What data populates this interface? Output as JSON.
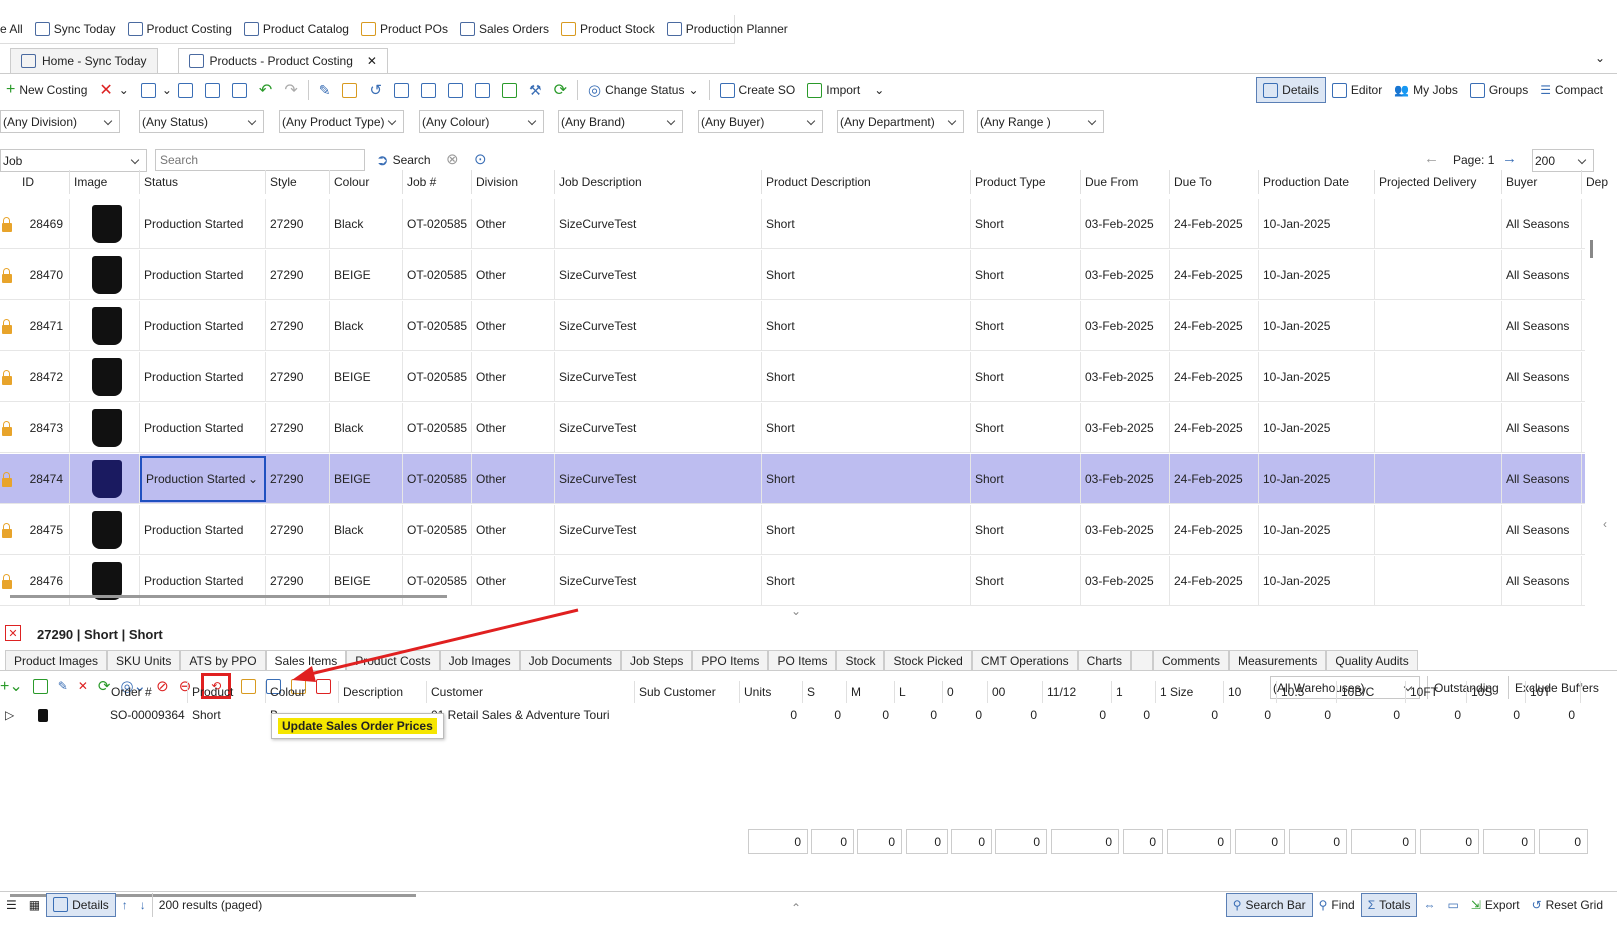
{
  "favorites": [
    "e All",
    "Sync Today",
    "Product Costing",
    "Product Catalog",
    "Product POs",
    "Sales Orders",
    "Product Stock",
    "Production Planner"
  ],
  "doc_tabs": [
    {
      "label": "Home - Sync Today"
    },
    {
      "label": "Products - Product Costing"
    }
  ],
  "toolbar": {
    "new_costing": "New Costing",
    "change_status": "Change Status",
    "create_so": "Create SO",
    "import": "Import"
  },
  "view_buttons": [
    "Details",
    "Editor",
    "My Jobs",
    "Groups",
    "Compact"
  ],
  "filters": [
    "(Any Division)",
    "(Any Status)",
    "(Any Product Type)",
    "(Any Colour)",
    "(Any Brand)",
    "(Any Buyer)",
    "(Any Department)",
    "(Any Range )"
  ],
  "search": {
    "field": "Job",
    "placeholder": "Search",
    "button": "Search",
    "page_label": "Page: 1",
    "page_size": "200"
  },
  "columns": [
    "ID",
    "Image",
    "Status",
    "Style",
    "Colour",
    "Job #",
    "Division",
    "Job Description",
    "Product Description",
    "Product Type",
    "Due From",
    "Due To",
    "Production Date",
    "Projected Delivery",
    "Buyer",
    "Dep"
  ],
  "rows": [
    {
      "id": "28469",
      "status": "Production Started",
      "style": "27290",
      "colour": "Black",
      "job": "OT-020585",
      "division": "Other",
      "job_desc": "SizeCurveTest",
      "prod_desc": "Short",
      "type": "Short",
      "due_from": "03-Feb-2025",
      "due_to": "24-Feb-2025",
      "prod_date": "10-Jan-2025",
      "proj": "",
      "buyer": "All Seasons"
    },
    {
      "id": "28470",
      "status": "Production Started",
      "style": "27290",
      "colour": "BEIGE",
      "job": "OT-020585",
      "division": "Other",
      "job_desc": "SizeCurveTest",
      "prod_desc": "Short",
      "type": "Short",
      "due_from": "03-Feb-2025",
      "due_to": "24-Feb-2025",
      "prod_date": "10-Jan-2025",
      "proj": "",
      "buyer": "All Seasons"
    },
    {
      "id": "28471",
      "status": "Production Started",
      "style": "27290",
      "colour": "Black",
      "job": "OT-020585",
      "division": "Other",
      "job_desc": "SizeCurveTest",
      "prod_desc": "Short",
      "type": "Short",
      "due_from": "03-Feb-2025",
      "due_to": "24-Feb-2025",
      "prod_date": "10-Jan-2025",
      "proj": "",
      "buyer": "All Seasons"
    },
    {
      "id": "28472",
      "status": "Production Started",
      "style": "27290",
      "colour": "BEIGE",
      "job": "OT-020585",
      "division": "Other",
      "job_desc": "SizeCurveTest",
      "prod_desc": "Short",
      "type": "Short",
      "due_from": "03-Feb-2025",
      "due_to": "24-Feb-2025",
      "prod_date": "10-Jan-2025",
      "proj": "",
      "buyer": "All Seasons"
    },
    {
      "id": "28473",
      "status": "Production Started",
      "style": "27290",
      "colour": "Black",
      "job": "OT-020585",
      "division": "Other",
      "job_desc": "SizeCurveTest",
      "prod_desc": "Short",
      "type": "Short",
      "due_from": "03-Feb-2025",
      "due_to": "24-Feb-2025",
      "prod_date": "10-Jan-2025",
      "proj": "",
      "buyer": "All Seasons"
    },
    {
      "id": "28474",
      "status": "Production Started",
      "style": "27290",
      "colour": "BEIGE",
      "job": "OT-020585",
      "division": "Other",
      "job_desc": "SizeCurveTest",
      "prod_desc": "Short",
      "type": "Short",
      "due_from": "03-Feb-2025",
      "due_to": "24-Feb-2025",
      "prod_date": "10-Jan-2025",
      "proj": "",
      "buyer": "All Seasons"
    },
    {
      "id": "28475",
      "status": "Production Started",
      "style": "27290",
      "colour": "Black",
      "job": "OT-020585",
      "division": "Other",
      "job_desc": "SizeCurveTest",
      "prod_desc": "Short",
      "type": "Short",
      "due_from": "03-Feb-2025",
      "due_to": "24-Feb-2025",
      "prod_date": "10-Jan-2025",
      "proj": "",
      "buyer": "All Seasons"
    },
    {
      "id": "28476",
      "status": "Production Started",
      "style": "27290",
      "colour": "BEIGE",
      "job": "OT-020585",
      "division": "Other",
      "job_desc": "SizeCurveTest",
      "prod_desc": "Short",
      "type": "Short",
      "due_from": "03-Feb-2025",
      "due_to": "24-Feb-2025",
      "prod_date": "10-Jan-2025",
      "proj": "",
      "buyer": "All Seasons"
    }
  ],
  "selected_row_index": 5,
  "detail": {
    "title": "27290 | Short | Short",
    "tabs": [
      "Product Images",
      "SKU Units",
      "ATS by PPO",
      "Sales Items",
      "Product Costs",
      "Job Images",
      "Job Documents",
      "Job Steps",
      "PPO Items",
      "PO Items",
      "Stock",
      "Stock Picked",
      "CMT Operations",
      "Charts",
      "",
      "Comments",
      "Measurements",
      "Quality Audits"
    ],
    "active_tab": "Sales Items",
    "warehouse": "(All Warehouses)",
    "outstanding": "Outstanding",
    "exclude_buffers": "Exclude Buffers",
    "tooltip": "Update Sales Order Prices",
    "columns": [
      "Order #",
      "Product",
      "Colour",
      "Description",
      "Customer",
      "Sub Customer",
      "Units",
      "S",
      "M",
      "L",
      "0",
      "00",
      "11/12",
      "1",
      "1 Size",
      "10",
      "10.5",
      "10B/C",
      "10FT",
      "10S",
      "10T"
    ],
    "row": {
      "order": "SO-00009364",
      "product": "Short",
      "colour": "B",
      "customer": "01 Retail Sales & Adventure Touri",
      "sub_customer": "",
      "units": "0",
      "sizes": [
        "0",
        "0",
        "0",
        "0",
        "0",
        "0",
        "0",
        "0",
        "0",
        "0",
        "0",
        "0",
        "0",
        "0"
      ]
    },
    "totals": [
      "0",
      "0",
      "0",
      "0",
      "0",
      "0",
      "0",
      "0",
      "0",
      "0",
      "0",
      "0",
      "0",
      "0",
      "0"
    ]
  },
  "status_bar": {
    "details": "Details",
    "results": "200 results (paged)",
    "search_bar": "Search Bar",
    "find": "Find",
    "totals": "Totals",
    "export": "Export",
    "reset_grid": "Reset Grid"
  },
  "colors": {
    "selected_row": "#bdbdf0",
    "tooltip_bg": "#f5e600",
    "highlight": "#e02020"
  }
}
